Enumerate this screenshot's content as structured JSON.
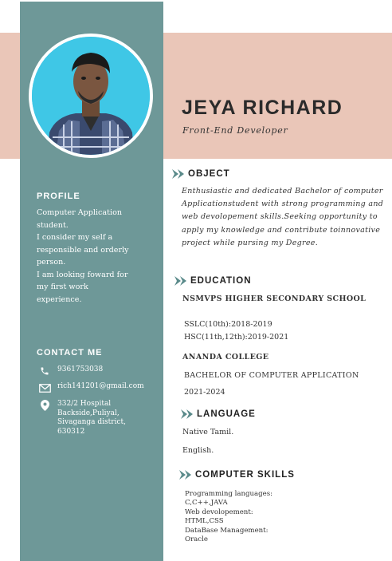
{
  "header": {
    "name": "JEYA RICHARD",
    "role": "Front-End Developer"
  },
  "profile": {
    "heading": "PROFILE",
    "text": " Computer Application\nstudent.\nI consider my self a\nresponsible and orderly\nperson.\nI am looking foward for\nmy first work\nexperience."
  },
  "contact": {
    "heading": "CONTACT ME",
    "phone": "9361753038",
    "email": "rich141201@gmail.com",
    "address": "332/2 Hospital Backside,Puliyal, Sivaganga district, 630312",
    "icons": [
      "phone-icon",
      "mail-icon",
      "location-pin-icon"
    ]
  },
  "object": {
    "heading": "OBJECT",
    "text": "Enthusiastic and dedicated Bachelor of computer Applicationstudent with strong programming and web devolopement skills.Seeking opportunity to apply my knowledge and contribute toinnovative project while pursing my Degree."
  },
  "education": {
    "heading": "EDUCATION",
    "school": "NSMVPS HIGHER SECONDARY SCHOOL",
    "sslc": "SSLC(10th):2018-2019",
    "hsc": "HSC(11th,12th):2019-2021",
    "college": "ANANDA COLLEGE",
    "degree": "BACHELOR OF COMPUTER APPLICATION",
    "years": "2021-2024"
  },
  "language": {
    "heading": "LANGUAGE",
    "items": [
      "Native Tamil.",
      "English."
    ]
  },
  "skills": {
    "heading": "COMPUTER SKILLS",
    "text": "Programming languages:\nC,C++,JAVA\nWeb devolopement:\nHTML,CSS\nDataBase Management:\nOracle"
  },
  "colors": {
    "sidebar": "#6e9898",
    "band": "#eac6b8",
    "accent": "#5a8a8a",
    "photo_bg": "#3fc7e6"
  }
}
